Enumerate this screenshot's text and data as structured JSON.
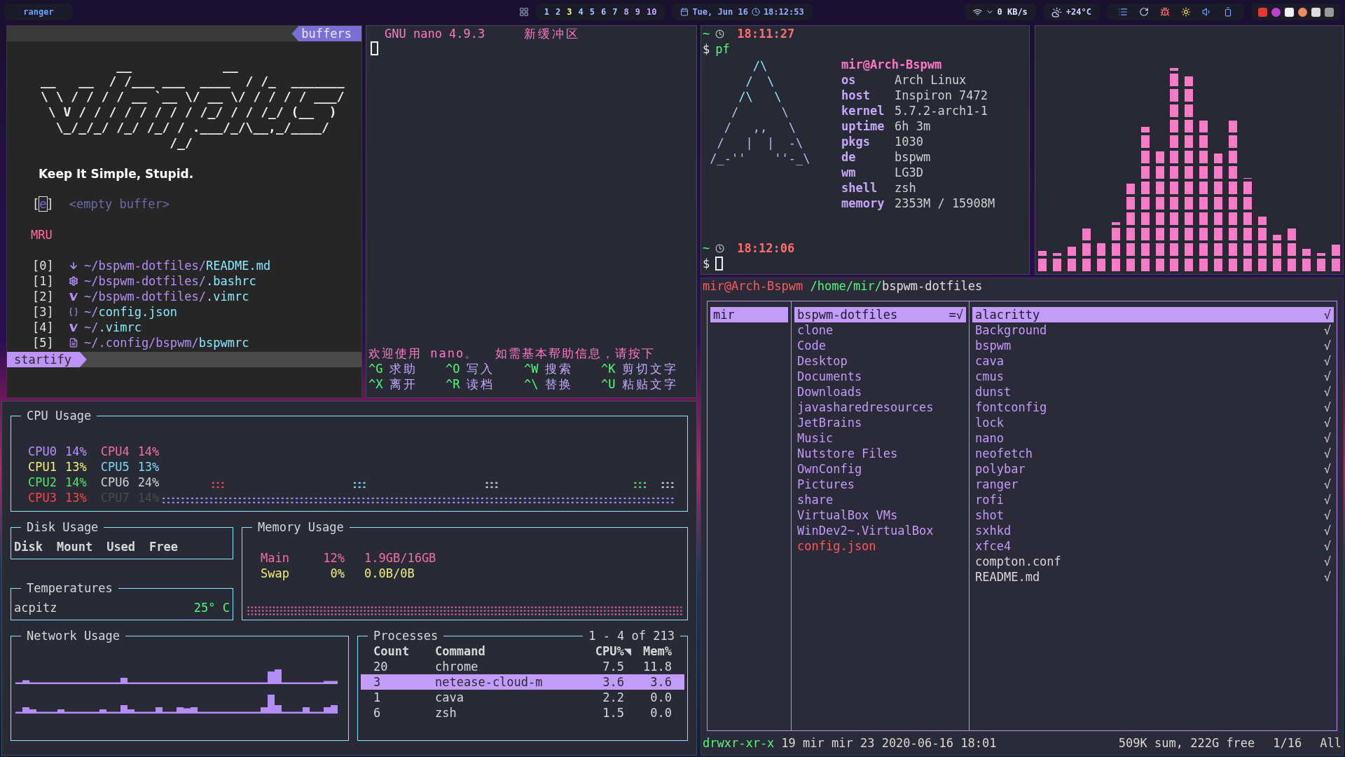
{
  "top_bar": {
    "window_label": "ranger",
    "workspaces": [
      {
        "label": "1",
        "selected": false
      },
      {
        "label": "2",
        "selected": false
      },
      {
        "label": "3",
        "selected": true
      },
      {
        "label": "4",
        "selected": false
      },
      {
        "label": "5",
        "selected": false
      },
      {
        "label": "6",
        "selected": false
      },
      {
        "label": "7",
        "selected": false
      },
      {
        "label": "8",
        "selected": false
      },
      {
        "label": "9",
        "selected": false
      },
      {
        "label": "10",
        "selected": false
      }
    ],
    "date": "Tue, Jun 16",
    "time": "18:12:53",
    "network_speed": "0 KB/s",
    "weather": "+24°C"
  },
  "vim": {
    "tabline_label": "buffers",
    "logo_lines": [
      "          __            __",
      "__   __  / /___ ___  ____  / /_  _______",
      "\\ \\ / / / / __ `__ \\/ __ \\/ / / / / ___/",
      " \\ V / / / / / / / / /_/ / / /_/ (__  )",
      "  \\_/_/_/ /_/ /_/ / .___/_/\\__,_/____/",
      "                 /_/"
    ],
    "tagline": "Keep It Simple, Stupid.",
    "empty_buffer": {
      "bracket_open": "[",
      "key": "e",
      "bracket_close": "]",
      "label": "<empty buffer>"
    },
    "section_title": "MRU",
    "recent_files": [
      {
        "index": "[0]",
        "kind": "markdown",
        "dir": "~/bspwm-dotfiles/",
        "name": "README.md"
      },
      {
        "index": "[1]",
        "kind": "shell",
        "dir": "~/bspwm-dotfiles/",
        "name": ".bashrc"
      },
      {
        "index": "[2]",
        "kind": "vim",
        "dir": "~/bspwm-dotfiles/",
        "name": ".vimrc"
      },
      {
        "index": "[3]",
        "kind": "json",
        "dir": "~/",
        "name": "config.json"
      },
      {
        "index": "[4]",
        "kind": "vim",
        "dir": "~/",
        "name": ".vimrc"
      },
      {
        "index": "[5]",
        "kind": "text",
        "dir": "~/.config/bspwm/",
        "name": "bspwmrc"
      }
    ],
    "mode": "startify"
  },
  "nano": {
    "title": "GNU nano 4.9.3",
    "buffer_name": "新缓冲区",
    "message": "欢迎使用 nano。  如需基本帮助信息，请按下",
    "shortcuts": [
      {
        "key": "^G",
        "label": "求助"
      },
      {
        "key": "^O",
        "label": "写入"
      },
      {
        "key": "^W",
        "label": "搜索"
      },
      {
        "key": "^K",
        "label": "剪切文字"
      },
      {
        "key": "^X",
        "label": "离开"
      },
      {
        "key": "^R",
        "label": "读档"
      },
      {
        "key": "^\\",
        "label": "替换"
      },
      {
        "key": "^U",
        "label": "粘贴文字"
      }
    ]
  },
  "neofetch": {
    "prompts": [
      {
        "dir": "~",
        "time": "18:11:27",
        "symbol": "$",
        "command": "pf"
      },
      {
        "dir": "~",
        "time": "18:12:06",
        "symbol": "$"
      }
    ],
    "logo_lines": [
      "       /\\",
      "      /  \\",
      "     /\\   \\",
      "    /      \\",
      "   /   ,,   \\",
      "  /   |  |  -\\",
      " /_-''    ''-_\\"
    ],
    "user": "mir@Arch-Bspwm",
    "info": [
      {
        "key": "os",
        "value": "Arch Linux"
      },
      {
        "key": "host",
        "value": "Inspiron 7472"
      },
      {
        "key": "kernel",
        "value": "5.7.2-arch1-1"
      },
      {
        "key": "uptime",
        "value": "6h 3m"
      },
      {
        "key": "pkgs",
        "value": "1030"
      },
      {
        "key": "de",
        "value": "bspwm"
      },
      {
        "key": "wm",
        "value": "LG3D"
      },
      {
        "key": "shell",
        "value": "zsh"
      },
      {
        "key": "memory",
        "value": "2353M / 15908M"
      }
    ]
  },
  "gtop": {
    "cpu": {
      "title": "CPU Usage",
      "cores": [
        {
          "label": "CPU0",
          "value": "14%",
          "color": "#b892f5"
        },
        {
          "label": "CPU4",
          "value": "14%",
          "color": "#f06fa8"
        },
        {
          "label": "CPU1",
          "value": "13%",
          "color": "#eef07a"
        },
        {
          "label": "CPU5",
          "value": "13%",
          "color": "#7fd8f0"
        },
        {
          "label": "CPU2",
          "value": "14%",
          "color": "#55e06a"
        },
        {
          "label": "CPU6",
          "value": "24%",
          "color": "#d0d0d0"
        },
        {
          "label": "CPU3",
          "value": "13%",
          "color": "#ef4a4a"
        },
        {
          "label": "CPU7",
          "value": "14%",
          "color": "#4a4a4a"
        }
      ]
    },
    "disk": {
      "title": "Disk Usage",
      "columns": [
        "Disk",
        "Mount",
        "Used",
        "Free"
      ]
    },
    "temperatures": {
      "title": "Temperatures",
      "sensors": [
        {
          "name": "acpitz",
          "value": "25° C"
        }
      ]
    },
    "memory": {
      "title": "Memory Usage",
      "rows": [
        {
          "label": "Main",
          "percent": "12%",
          "amount": "1.9GB/16GB",
          "color": "#f06fa8"
        },
        {
          "label": "Swap",
          "percent": "0%",
          "amount": "0.0B/0B",
          "color": "#eef07a"
        }
      ]
    },
    "network": {
      "title": "Network Usage"
    },
    "processes": {
      "title": "Processes",
      "range": "1 - 4 of 213",
      "columns": [
        "Count",
        "Command",
        "CPU%◥",
        "Mem%"
      ],
      "rows": [
        {
          "count": "20",
          "command": "chrome",
          "cpu": "7.5",
          "mem": "11.8",
          "selected": false
        },
        {
          "count": "3",
          "command": "netease-cloud-m",
          "cpu": "3.6",
          "mem": "3.6",
          "selected": true
        },
        {
          "count": "1",
          "command": "cava",
          "cpu": "2.2",
          "mem": "0.0",
          "selected": false
        },
        {
          "count": "6",
          "command": "zsh",
          "cpu": "1.5",
          "mem": "0.0",
          "selected": false
        }
      ]
    }
  },
  "ranger": {
    "header": {
      "host": "mir@Arch-Bspwm",
      "path": "/home/mir/",
      "current": "bspwm-dotfiles"
    },
    "parent_column": [
      {
        "name": "mir",
        "selected": true
      }
    ],
    "current_column": [
      {
        "name": "bspwm-dotfiles",
        "kind": "dir",
        "selected": true,
        "tag": "=√"
      },
      {
        "name": "clone",
        "kind": "dir",
        "selected": false
      },
      {
        "name": "Code",
        "kind": "dir",
        "selected": false
      },
      {
        "name": "Desktop",
        "kind": "dir",
        "selected": false
      },
      {
        "name": "Documents",
        "kind": "dir",
        "selected": false
      },
      {
        "name": "Downloads",
        "kind": "dir",
        "selected": false
      },
      {
        "name": "javasharedresources",
        "kind": "dir",
        "selected": false
      },
      {
        "name": "JetBrains",
        "kind": "dir",
        "selected": false
      },
      {
        "name": "Music",
        "kind": "dir",
        "selected": false
      },
      {
        "name": "Nutstore Files",
        "kind": "dir",
        "selected": false
      },
      {
        "name": "OwnConfig",
        "kind": "dir",
        "selected": false
      },
      {
        "name": "Pictures",
        "kind": "dir",
        "selected": false
      },
      {
        "name": "share",
        "kind": "dir",
        "selected": false
      },
      {
        "name": "VirtualBox VMs",
        "kind": "dir",
        "selected": false
      },
      {
        "name": "WinDev2~.VirtualBox",
        "kind": "dir",
        "selected": false
      },
      {
        "name": "config.json",
        "kind": "special",
        "selected": false
      }
    ],
    "preview_column": [
      {
        "name": "alacritty",
        "kind": "dir",
        "selected": true,
        "tag": "√"
      },
      {
        "name": "Background",
        "kind": "dir",
        "selected": false,
        "tag": "√"
      },
      {
        "name": "bspwm",
        "kind": "dir",
        "selected": false,
        "tag": "√"
      },
      {
        "name": "cava",
        "kind": "dir",
        "selected": false,
        "tag": "√"
      },
      {
        "name": "cmus",
        "kind": "dir",
        "selected": false,
        "tag": "√"
      },
      {
        "name": "dunst",
        "kind": "dir",
        "selected": false,
        "tag": "√"
      },
      {
        "name": "fontconfig",
        "kind": "dir",
        "selected": false,
        "tag": "√"
      },
      {
        "name": "lock",
        "kind": "dir",
        "selected": false,
        "tag": "√"
      },
      {
        "name": "nano",
        "kind": "dir",
        "selected": false,
        "tag": "√"
      },
      {
        "name": "neofetch",
        "kind": "dir",
        "selected": false,
        "tag": "√"
      },
      {
        "name": "polybar",
        "kind": "dir",
        "selected": false,
        "tag": "√"
      },
      {
        "name": "ranger",
        "kind": "dir",
        "selected": false,
        "tag": "√"
      },
      {
        "name": "rofi",
        "kind": "dir",
        "selected": false,
        "tag": "√"
      },
      {
        "name": "shot",
        "kind": "dir",
        "selected": false,
        "tag": "√"
      },
      {
        "name": "sxhkd",
        "kind": "dir",
        "selected": false,
        "tag": "√"
      },
      {
        "name": "xfce4",
        "kind": "dir",
        "selected": false,
        "tag": "√"
      },
      {
        "name": "compton.conf",
        "kind": "file",
        "selected": false,
        "tag": "√"
      },
      {
        "name": "README.md",
        "kind": "file",
        "selected": false,
        "tag": "√"
      }
    ],
    "status": {
      "permissions": "drwxr-xr-x",
      "info": "19 mir mir 23 2020-06-16 18:01",
      "summary": "509K sum, 222G free",
      "position": "1/16",
      "scroll": "All"
    }
  }
}
